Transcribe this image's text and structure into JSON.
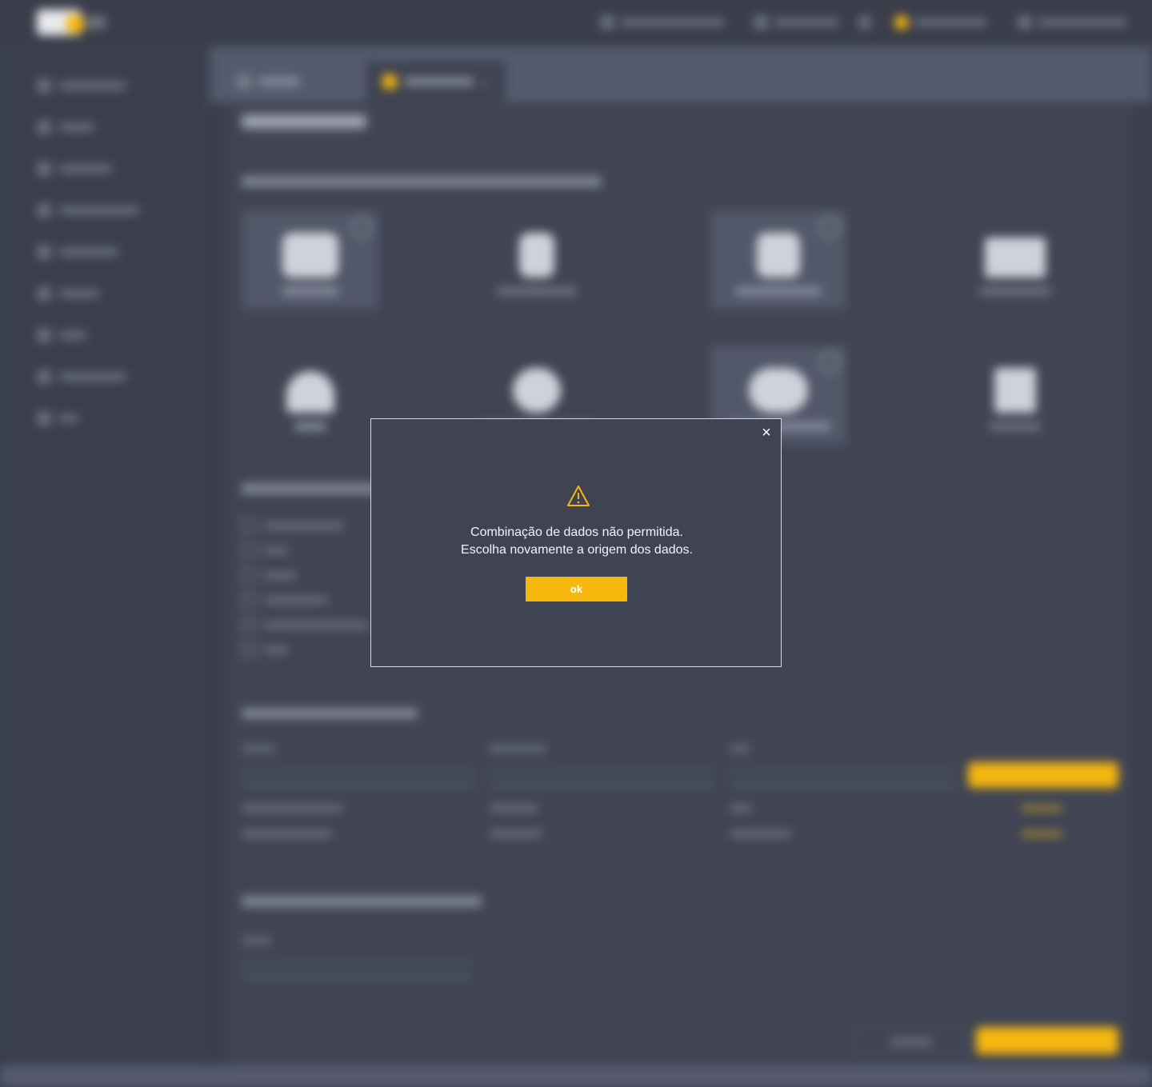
{
  "modal": {
    "message_line1": "Combinação de dados não permitida.",
    "message_line2": "Escolha novamente a origem dos dados.",
    "ok_label": "ok",
    "close_glyph": "×",
    "icon": "warning-triangle-icon",
    "accent_color": "#f7b80d"
  },
  "background": {
    "blurred": true,
    "accent_color": "#f5b70f"
  }
}
